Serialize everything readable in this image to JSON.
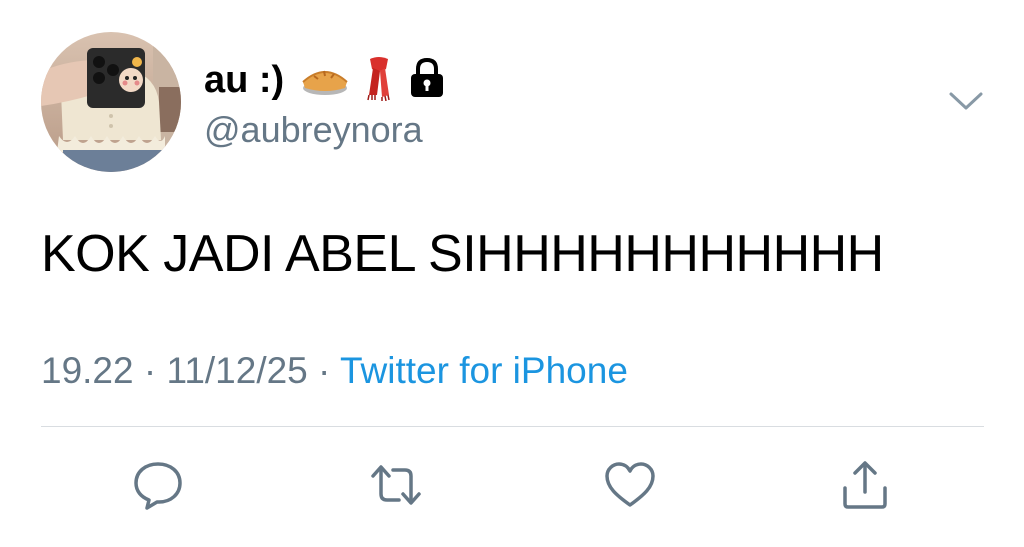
{
  "tweet": {
    "author": {
      "display_name": "au :)",
      "name_emojis": [
        "pie-emoji",
        "scarf-emoji",
        "lock-icon"
      ],
      "handle": "@aubreynora",
      "avatar": "profile-photo"
    },
    "text": "KOK JADI ABEL SIHHHHHHHHHHH",
    "meta": {
      "time": "19.22",
      "separator_1": " · ",
      "date": "11/12/25",
      "separator_2": " · ",
      "source": "Twitter for iPhone"
    },
    "actions": [
      {
        "name": "reply",
        "icon": "speech-bubble-icon"
      },
      {
        "name": "retweet",
        "icon": "retweet-icon"
      },
      {
        "name": "like",
        "icon": "heart-icon"
      },
      {
        "name": "share",
        "icon": "share-icon"
      }
    ]
  },
  "colors": {
    "text_primary": "#000000",
    "text_secondary": "#657786",
    "link": "#1b95e0",
    "icon": "#657786",
    "divider": "#d9dde1",
    "background": "#ffffff"
  }
}
